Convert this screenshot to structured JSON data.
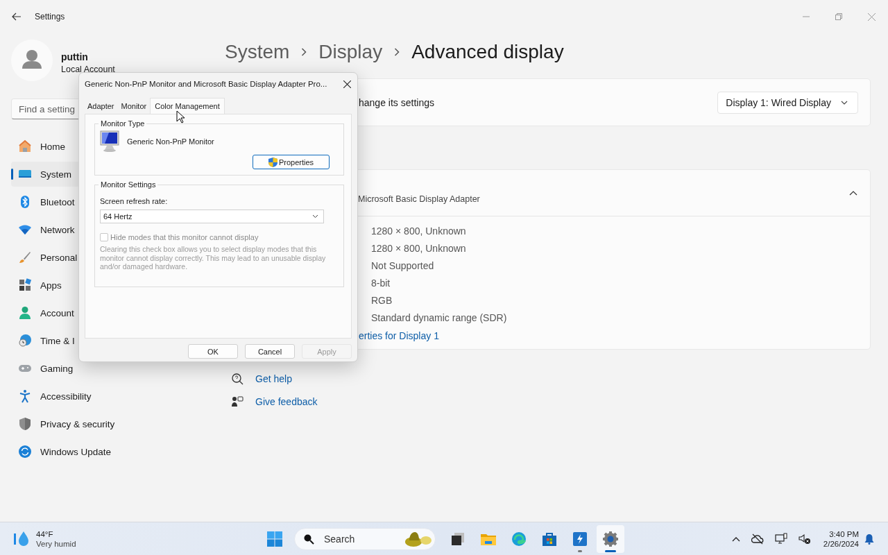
{
  "window": {
    "title": "Settings"
  },
  "user": {
    "name": "puttin",
    "account": "Local Account"
  },
  "search": {
    "placeholder": "Find a setting"
  },
  "sidebar": {
    "items": [
      {
        "label": "Home",
        "kind": "home",
        "selected": false
      },
      {
        "label": "System",
        "kind": "system",
        "selected": true
      },
      {
        "label": "Bluetoot",
        "kind": "bluetooth",
        "selected": false
      },
      {
        "label": "Network",
        "kind": "network",
        "selected": false
      },
      {
        "label": "Personal",
        "kind": "personalization",
        "selected": false
      },
      {
        "label": "Apps",
        "kind": "apps",
        "selected": false
      },
      {
        "label": "Account",
        "kind": "accounts",
        "selected": false
      },
      {
        "label": "Time & I",
        "kind": "time",
        "selected": false
      },
      {
        "label": "Gaming",
        "kind": "gaming",
        "selected": false
      },
      {
        "label": "Accessibility",
        "kind": "accessibility",
        "selected": false
      },
      {
        "label": "Privacy & security",
        "kind": "privacy",
        "selected": false
      },
      {
        "label": "Windows Update",
        "kind": "update",
        "selected": false
      }
    ]
  },
  "breadcrumb": [
    "System",
    "Display",
    "Advanced display"
  ],
  "display_select": {
    "label": "hange its settings",
    "value": "Display 1: Wired Display"
  },
  "display_info": {
    "subtitle": "Microsoft Basic Display Adapter",
    "expanded": true,
    "rows": [
      "1280 × 800, Unknown",
      "1280 × 800, Unknown",
      "Not Supported",
      "8-bit",
      "RGB",
      "Standard dynamic range (SDR)"
    ],
    "link": "erties for Display 1"
  },
  "help_links": [
    {
      "label": "Get help",
      "kind": "help"
    },
    {
      "label": "Give feedback",
      "kind": "feedback"
    }
  ],
  "dialog": {
    "title": "Generic Non-PnP Monitor and Microsoft Basic Display Adapter Pro...",
    "tabs": [
      {
        "label": "Adapter",
        "selected": false
      },
      {
        "label": "Monitor",
        "selected": false
      },
      {
        "label": "Color Management",
        "selected": true
      }
    ],
    "monitor_type": {
      "legend": "Monitor Type",
      "name": "Generic Non-PnP Monitor",
      "button": "Properties"
    },
    "monitor_settings": {
      "legend": "Monitor Settings",
      "refresh_label": "Screen refresh rate:",
      "refresh_value": "64 Hertz",
      "hide_modes": {
        "label": "Hide modes that this monitor cannot display",
        "checked": false,
        "disabled": true
      },
      "note": "Clearing this check box allows you to select display modes that this monitor cannot display correctly. This may lead to an unusable display and/or damaged hardware."
    },
    "buttons": [
      {
        "label": "OK",
        "disabled": false
      },
      {
        "label": "Cancel",
        "disabled": false
      },
      {
        "label": "Apply",
        "disabled": true
      }
    ]
  },
  "taskbar": {
    "weather": {
      "temp": "44°F",
      "condition": "Very humid"
    },
    "search": {
      "placeholder": "Search"
    },
    "apps": [
      {
        "kind": "taskview",
        "selected": false,
        "running": false
      },
      {
        "kind": "explorer",
        "selected": false,
        "running": false
      },
      {
        "kind": "edge",
        "selected": false,
        "running": false
      },
      {
        "kind": "store",
        "selected": false,
        "running": false
      },
      {
        "kind": "tool",
        "selected": false,
        "running": true
      },
      {
        "kind": "settings",
        "selected": true,
        "running": true
      }
    ],
    "time": "3:40 PM",
    "date": "2/26/2024"
  }
}
